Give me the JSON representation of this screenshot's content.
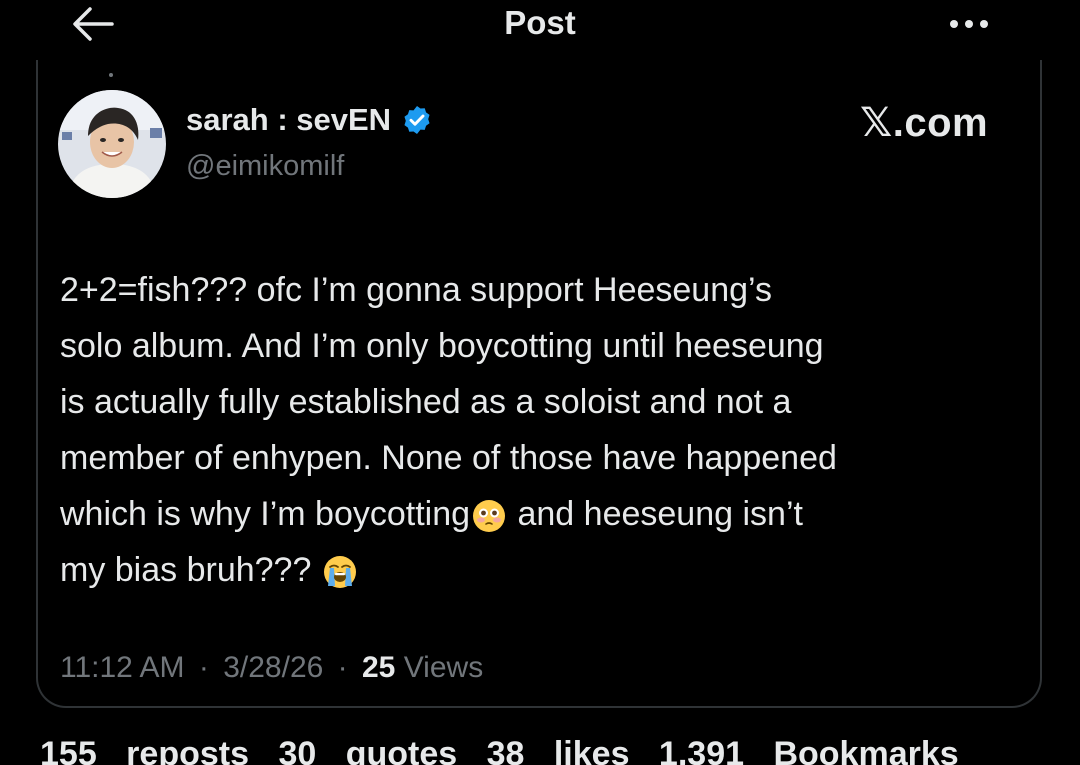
{
  "header": {
    "title": "Post"
  },
  "author": {
    "display_name": "sarah : sevEN",
    "handle": "@eimikomilf",
    "verified": true,
    "badge_color": "#1d9bf0"
  },
  "watermark": {
    "site": "𝕏.com"
  },
  "post": {
    "lines": [
      "2+2=fish??? ofc I’m gonna support Heeseung’s",
      "solo album. And I’m only boycotting until heeseung",
      "is actually fully established as a soloist and not a",
      "member of enhypen. None of those have happened"
    ],
    "line5_before_emoji": "which is why I’m boycotting",
    "line5_after_emoji": " and heeseung isn’t",
    "line6": "my bias bruh??? ",
    "emoji_1": "flushed-face-emoji",
    "emoji_2": "loudly-crying-face-emoji"
  },
  "meta": {
    "time": "11:12 AM",
    "separator": "·",
    "date": "3/28/26",
    "views_count": "25",
    "views_label": " Views"
  },
  "stats_partial": {
    "text": "155 reposts 30 quotes 38 likes 1,391 Bookmarks"
  },
  "colors": {
    "background": "#000000",
    "text": "#e7e9ea",
    "secondary_text": "#71767b",
    "border": "#2f3336",
    "accent": "#1d9bf0"
  }
}
